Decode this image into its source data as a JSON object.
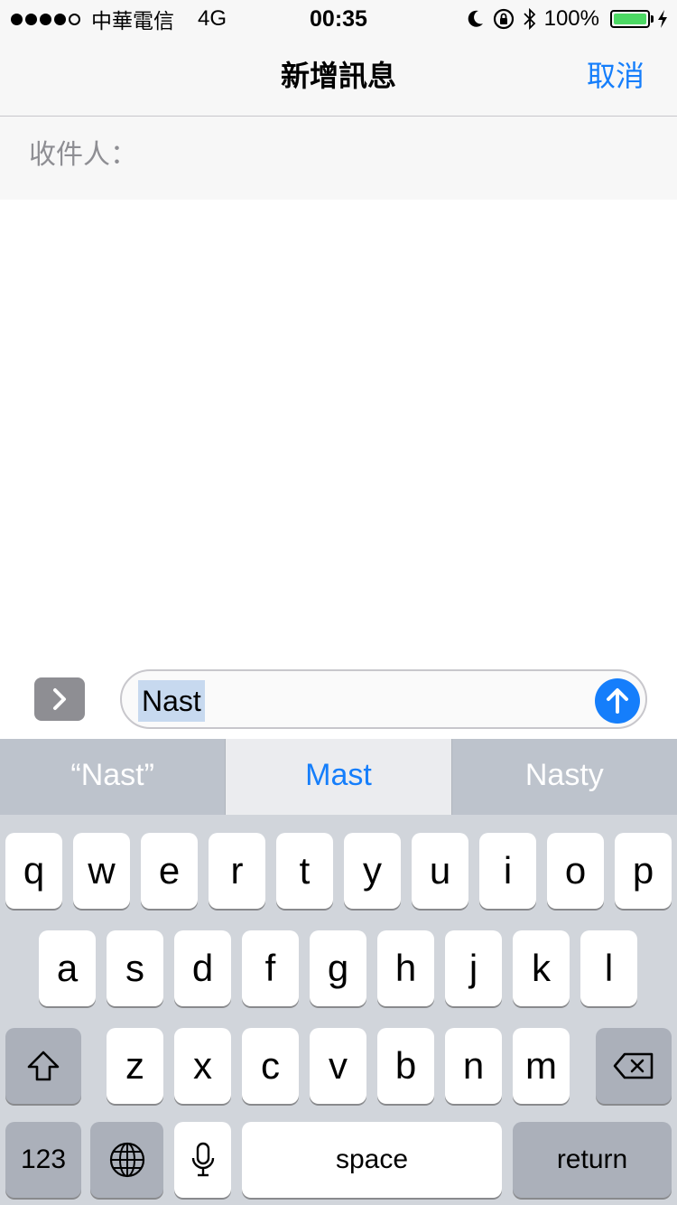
{
  "status_bar": {
    "carrier": "中華電信",
    "network": "4G",
    "time": "00:35",
    "battery_percent": "100%",
    "battery_level": 1.0,
    "signal_bars": 4,
    "signal_total": 5,
    "icons": [
      "moon-icon",
      "rotation-lock-icon",
      "bluetooth-icon",
      "battery-icon",
      "charging-icon"
    ]
  },
  "nav": {
    "title": "新增訊息",
    "cancel_label": "取消"
  },
  "recipient": {
    "label": "收件人："
  },
  "compose": {
    "text": "Nast",
    "expand_icon": "chevron-right-icon",
    "send_icon": "arrow-up-icon"
  },
  "keyboard": {
    "suggestions": [
      "“Nast”",
      "Mast",
      "Nasty"
    ],
    "row1": [
      "q",
      "w",
      "e",
      "r",
      "t",
      "y",
      "u",
      "i",
      "o",
      "p"
    ],
    "row2": [
      "a",
      "s",
      "d",
      "f",
      "g",
      "h",
      "j",
      "k",
      "l"
    ],
    "row3": [
      "z",
      "x",
      "c",
      "v",
      "b",
      "n",
      "m"
    ],
    "numbers_label": "123",
    "space_label": "space",
    "return_label": "return"
  },
  "colors": {
    "accent": "#157efb",
    "battery_fill": "#4cd964",
    "keyboard_bg": "#d1d5db"
  }
}
